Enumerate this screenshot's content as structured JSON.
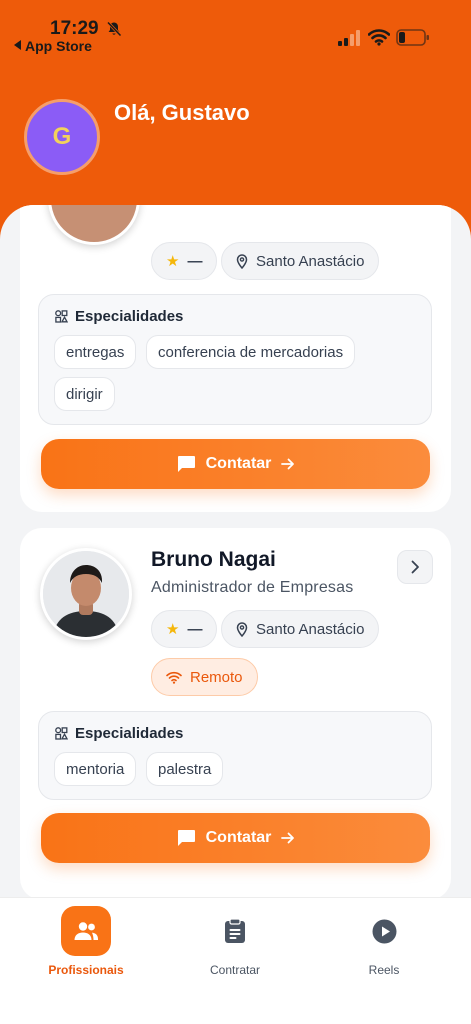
{
  "status_bar": {
    "time": "17:29",
    "back_label": "App Store"
  },
  "header": {
    "avatar_initial": "G",
    "greeting": "Olá, Gustavo"
  },
  "cards": [
    {
      "rating": "—",
      "location": "Santo Anastácio",
      "specialties_title": "Especialidades",
      "specialties": [
        "entregas",
        "conferencia de mercadorias",
        "dirigir"
      ],
      "contact_label": "Contatar"
    },
    {
      "name": "Bruno Nagai",
      "role": "Administrador de Empresas",
      "rating": "—",
      "location": "Santo Anastácio",
      "remote_label": "Remoto",
      "specialties_title": "Especialidades",
      "specialties": [
        "mentoria",
        "palestra"
      ],
      "contact_label": "Contatar"
    }
  ],
  "tabbar": {
    "tabs": [
      {
        "label": "Profissionais",
        "icon": "users-icon",
        "active": true
      },
      {
        "label": "Contratar",
        "icon": "clipboard-icon",
        "active": false
      },
      {
        "label": "Reels",
        "icon": "play-circle-icon",
        "active": false
      }
    ]
  },
  "colors": {
    "brand": "#EE5B0A",
    "accent": "#F97316",
    "avatar": "#8B5CF6"
  }
}
